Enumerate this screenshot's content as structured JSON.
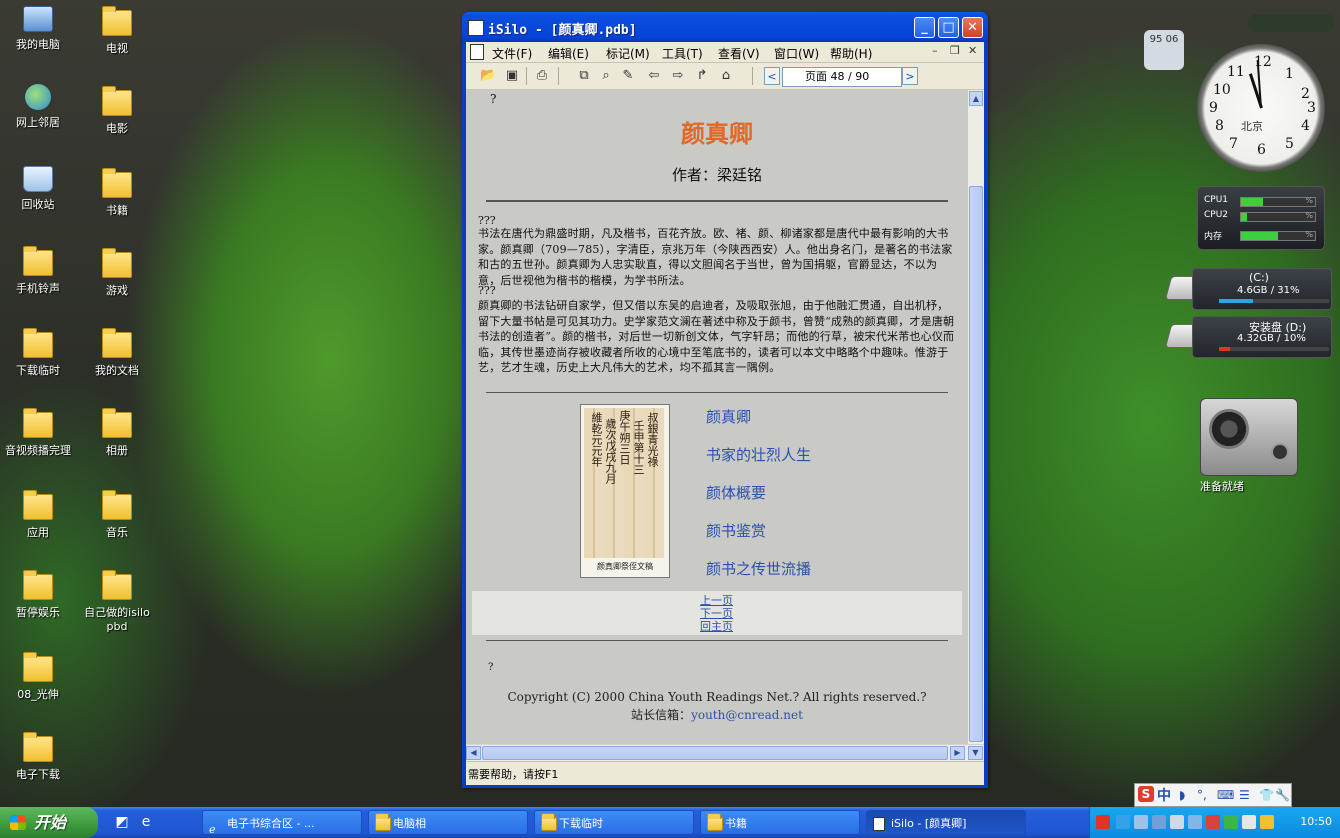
{
  "desktop": {
    "icons_left": [
      {
        "label": "我的电脑",
        "icon": "computer-icon"
      },
      {
        "label": "网上邻居",
        "icon": "network-icon"
      },
      {
        "label": "回收站",
        "icon": "recycle-bin-icon"
      },
      {
        "label": "手机铃声",
        "icon": "folder-icon"
      },
      {
        "label": "下载临时",
        "icon": "folder-icon"
      },
      {
        "label": "音视频播完理",
        "icon": "folder-icon"
      },
      {
        "label": "应用",
        "icon": "folder-icon"
      },
      {
        "label": "暂停娱乐",
        "icon": "folder-icon"
      },
      {
        "label": "08_光伸",
        "icon": "folder-icon"
      },
      {
        "label": "电子下载",
        "icon": "folder-icon"
      }
    ],
    "icons_right": [
      {
        "label": "电视",
        "icon": "folder-icon"
      },
      {
        "label": "电影",
        "icon": "folder-icon"
      },
      {
        "label": "书籍",
        "icon": "folder-icon"
      },
      {
        "label": "游戏",
        "icon": "folder-icon"
      },
      {
        "label": "我的文档",
        "icon": "folder-icon"
      },
      {
        "label": "相册",
        "icon": "folder-icon"
      },
      {
        "label": "音乐",
        "icon": "folder-icon"
      },
      {
        "label": "自己做的isilo pbd",
        "icon": "folder-icon"
      }
    ]
  },
  "window": {
    "title": "iSilo - [颜真卿.pdb]",
    "menus": [
      "文件(F)",
      "编辑(E)",
      "标记(M)",
      "工具(T)",
      "查看(V)",
      "窗口(W)",
      "帮助(H)"
    ],
    "page_indicator": "页面 48 / 90",
    "status": "需要帮助，请按F1"
  },
  "document": {
    "top_mark": "?",
    "title": "颜真卿",
    "author": "作者：梁廷铭",
    "marker1": "???",
    "paragraph1": "书法在唐代为鼎盛时期，凡及楷书，百花齐放。欧、褚、颜、柳诸家都是唐代中最有影响的大书家。颜真卿（709—785），字清臣，京兆万年（今陕西西安）人。他出身名门，是著名的书法家和古的五世孙。颜真卿为人忠实耿直，得以文胆闻名于当世，曾为国捐躯，官爵显达，不以为意，后世视他为楷书的楷模，为学书所法。",
    "marker2": "???",
    "paragraph2": "颜真卿的书法钻研自家学，但又借以东吴的启迪者，及吸取张旭，由于他融汇贯通，自出机杼，留下大量书帖是可见其功力。史学家范文澜在著述中称及于颜书，曾赞“成熟的颜真卿，才是唐朝书法的创造者”。颜的楷书，对后世一切新创文体，气字轩昂；而他的行草，被宋代米芾也心仪而临，其传世墨迹尚存被收藏者所收的心境中至笔底书的，读者可以本文中略略个中趣味。惟游于艺，艺才生魂，历史上大凡伟大的艺术，均不孤其言一隅例。",
    "image_caption": "颜真卿祭侄文稿",
    "toc": [
      "颜真卿",
      "书家的壮烈人生",
      "颜体概要",
      "颜书鉴赏",
      "颜书之传世流播"
    ],
    "nav_links": [
      "上一页",
      "下一页",
      "回主页"
    ],
    "bottom_mark": "?",
    "copyright": "Copyright (C) 2000 China Youth Readings Net.? All rights reserved.?",
    "email_label": "站长信箱：",
    "email": "youth@cnread.net"
  },
  "gadgets": {
    "weather": "95 06",
    "clock_city": "北京",
    "cpu": [
      {
        "label": "CPU1",
        "value": 0.3
      },
      {
        "label": "CPU2",
        "value": 0.08
      },
      {
        "label": "内存",
        "value": 0.5
      }
    ],
    "drives": [
      {
        "name": "(C:)",
        "info": "4.6GB / 31%",
        "usage": 0.31,
        "color": "#2aa8e0"
      },
      {
        "name": "安装盘 (D:)",
        "info": "4.32GB / 10%",
        "usage": 0.1,
        "color": "#d33a2a"
      }
    ],
    "radio_label": "准备就绪"
  },
  "taskbar": {
    "start": "开始",
    "buttons": [
      "电子书综合区 - ...",
      "电脑相",
      "下载临时",
      "书籍",
      "iSilo - [颜真卿]"
    ],
    "clock": "10:50"
  },
  "ime": {
    "label": "中"
  }
}
